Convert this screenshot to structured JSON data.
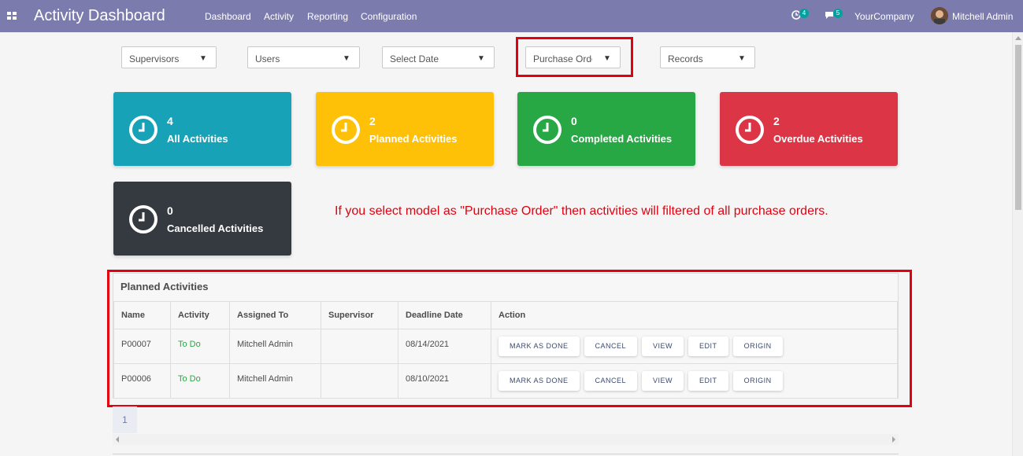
{
  "navbar": {
    "title": "Activity Dashboard",
    "menu": [
      "Dashboard",
      "Activity",
      "Reporting",
      "Configuration"
    ],
    "activity_count": "4",
    "message_count": "5",
    "company": "YourCompany",
    "user": "Mitchell Admin"
  },
  "filters": {
    "supervisors": "Supervisors",
    "users": "Users",
    "date": "Select Date",
    "model": "Purchase Order",
    "records": "Records"
  },
  "cards": [
    {
      "count": "4",
      "label": "All Activities",
      "color": "#17a2b8"
    },
    {
      "count": "2",
      "label": "Planned Activities",
      "color": "#ffc107"
    },
    {
      "count": "0",
      "label": "Completed Activities",
      "color": "#28a745"
    },
    {
      "count": "2",
      "label": "Overdue Activities",
      "color": "#dc3545"
    },
    {
      "count": "0",
      "label": "Cancelled Activities",
      "color": "#343a40"
    }
  ],
  "note": "If you select model as \"Purchase Order\" then activities will filtered of all purchase orders.",
  "table": {
    "title": "Planned Activities",
    "headers": [
      "Name",
      "Activity",
      "Assigned To",
      "Supervisor",
      "Deadline Date",
      "Action"
    ],
    "rows": [
      {
        "name": "P00007",
        "activity": "To Do",
        "assigned": "Mitchell Admin",
        "supervisor": "",
        "deadline": "08/14/2021"
      },
      {
        "name": "P00006",
        "activity": "To Do",
        "assigned": "Mitchell Admin",
        "supervisor": "",
        "deadline": "08/10/2021"
      }
    ],
    "actions": [
      "MARK AS DONE",
      "CANCEL",
      "VIEW",
      "EDIT",
      "ORIGIN"
    ]
  },
  "pager": {
    "page": "1"
  },
  "colors": {
    "navbar": "#7c7bad",
    "highlight": "#e3000f",
    "todo": "#28a745"
  }
}
